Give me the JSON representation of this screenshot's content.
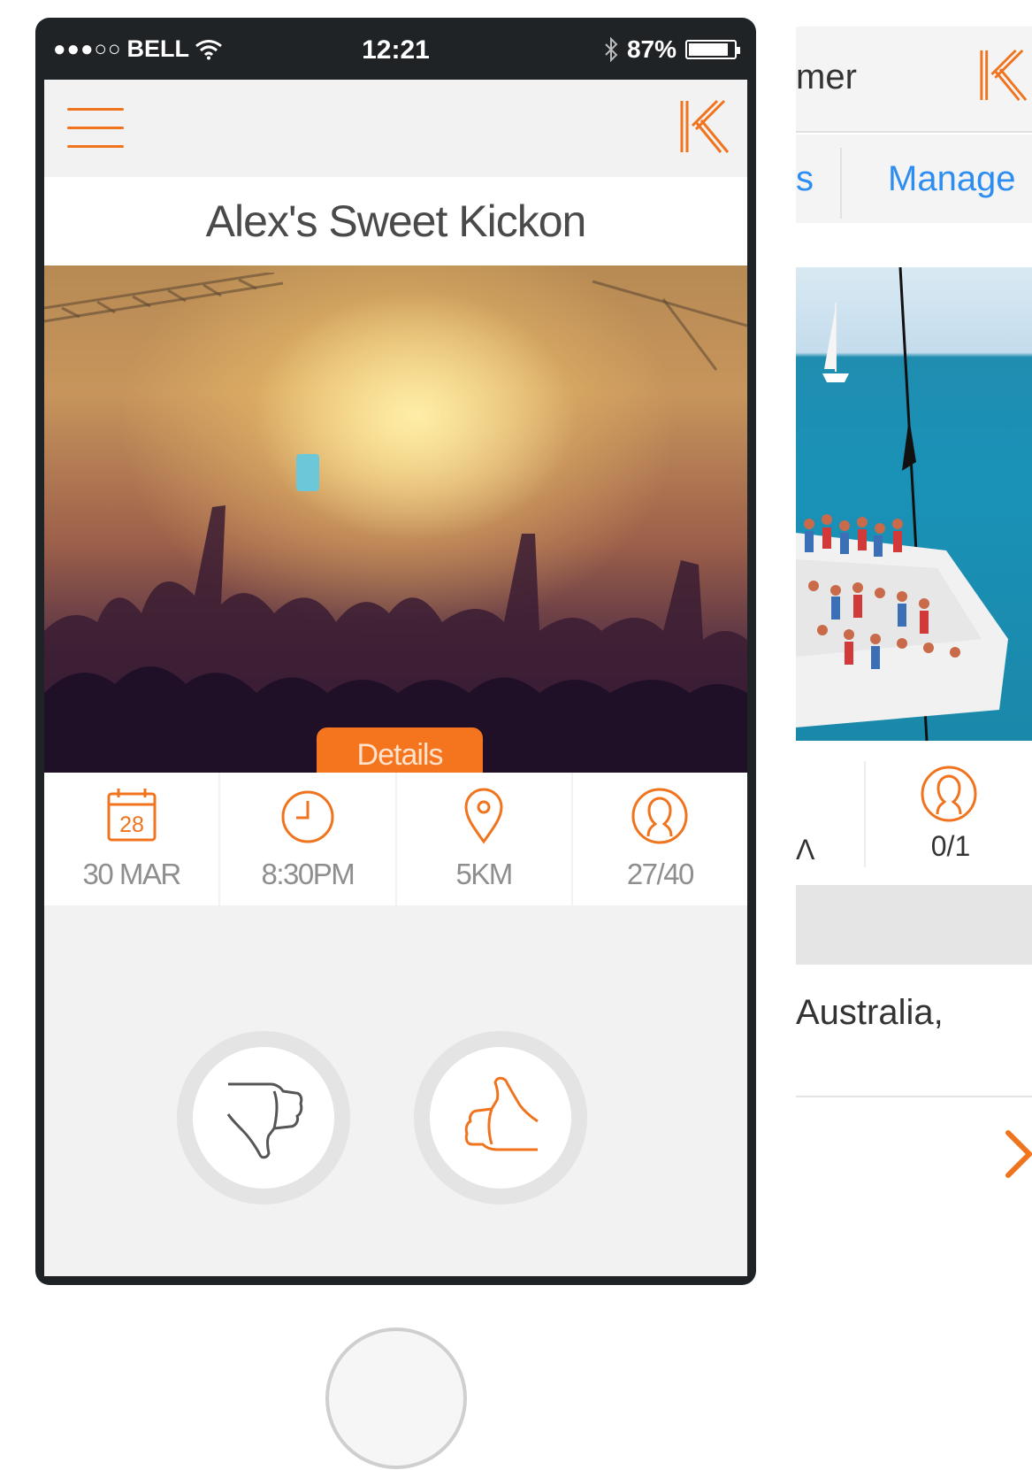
{
  "status_bar": {
    "signal": "●●●○○",
    "carrier": "BELL",
    "time": "12:21",
    "battery": "87%",
    "battery_level": 0.87
  },
  "event": {
    "title": "Alex's Sweet Kickon",
    "details_tab": "Details",
    "info": [
      {
        "icon": "calendar-icon",
        "icon_text": "28",
        "label": "30 MAR"
      },
      {
        "icon": "clock-icon",
        "label": "8:30PM"
      },
      {
        "icon": "location-pin-icon",
        "label": "5KM"
      },
      {
        "icon": "person-icon",
        "label": "27/40"
      }
    ]
  },
  "second_screen": {
    "title_fragment": "mer",
    "tab_fragment": "s",
    "manage_tab": "Manage",
    "info_fragment": "Λ",
    "info_label": "0/1",
    "address_fragment": "Australia,"
  },
  "colors": {
    "accent": "#f0731e",
    "link": "#2d8df0",
    "text_dark": "#4a4a4a",
    "text_muted": "#8e8e8e"
  }
}
